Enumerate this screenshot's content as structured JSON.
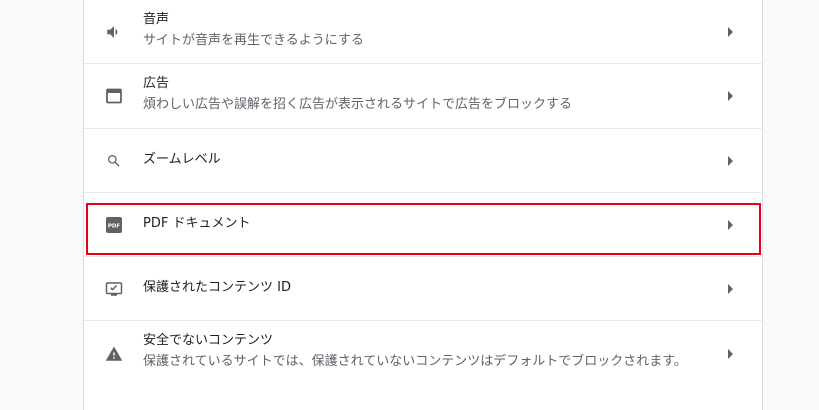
{
  "settings_list": {
    "items": [
      {
        "title": "音声",
        "description": "サイトが音声を再生できるようにする",
        "icon": "volume-icon"
      },
      {
        "title": "広告",
        "description": "煩わしい広告や誤解を招く広告が表示されるサイトで広告をブロックする",
        "icon": "ads-window-icon"
      },
      {
        "title": "ズームレベル",
        "description": "",
        "icon": "search-icon"
      },
      {
        "title": "PDF ドキュメント",
        "description": "",
        "icon": "pdf-icon"
      },
      {
        "title": "保護されたコンテンツ ID",
        "description": "",
        "icon": "protected-content-icon"
      },
      {
        "title": "安全でないコンテンツ",
        "description": "保護されているサイトでは、保護されていないコンテンツはデフォルトでブロックされます。",
        "icon": "warning-icon"
      }
    ]
  },
  "highlight": {
    "color": "#e60012",
    "target": "PDF ドキュメント"
  },
  "colors": {
    "title": "#202124",
    "description": "#5f6368",
    "icon": "#5f6368",
    "divider": "#e8eaed"
  }
}
